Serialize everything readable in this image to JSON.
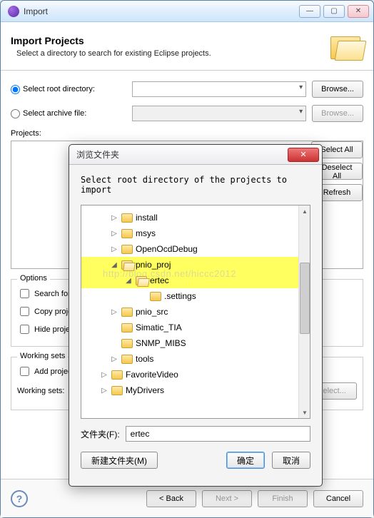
{
  "window": {
    "title": "Import",
    "banner_title": "Import Projects",
    "banner_desc": "Select a directory to search for existing Eclipse projects."
  },
  "source": {
    "root_label": "Select root directory:",
    "archive_label": "Select archive file:",
    "browse": "Browse...",
    "root_selected": true
  },
  "projects": {
    "label": "Projects:",
    "select_all": "Select All",
    "deselect_all": "Deselect All",
    "refresh": "Refresh"
  },
  "options": {
    "title": "Options",
    "search": "Search for nested projects",
    "copy": "Copy projects into workspace",
    "hide": "Hide projects that already exist in the workspace"
  },
  "working": {
    "title": "Working sets",
    "add": "Add project to working sets",
    "ws_label": "Working sets:",
    "select": "Select..."
  },
  "footer": {
    "back": "< Back",
    "next": "Next >",
    "finish": "Finish",
    "cancel": "Cancel"
  },
  "modal": {
    "title": "浏览文件夹",
    "message": "Select root directory of the projects to import",
    "path_label": "文件夹(F):",
    "path_value": "ertec",
    "new_folder": "新建文件夹(M)",
    "ok": "确定",
    "cancel": "取消",
    "watermark": "http://blog.csdn.net/hiccc2012",
    "tree": [
      {
        "label": "install",
        "indent": 40,
        "expander": "▷",
        "hl": false,
        "open": false
      },
      {
        "label": "msys",
        "indent": 40,
        "expander": "▷",
        "hl": false,
        "open": false
      },
      {
        "label": "OpenOcdDebug",
        "indent": 40,
        "expander": "▷",
        "hl": false,
        "open": false
      },
      {
        "label": "pnio_proj",
        "indent": 40,
        "expander": "◢",
        "hl": true,
        "open": true
      },
      {
        "label": "ertec",
        "indent": 60,
        "expander": "◢",
        "hl": true,
        "open": true
      },
      {
        "label": ".settings",
        "indent": 80,
        "expander": "",
        "hl": false,
        "open": false
      },
      {
        "label": "pnio_src",
        "indent": 40,
        "expander": "▷",
        "hl": false,
        "open": false
      },
      {
        "label": "Simatic_TIA",
        "indent": 40,
        "expander": "",
        "hl": false,
        "open": false
      },
      {
        "label": "SNMP_MIBS",
        "indent": 40,
        "expander": "",
        "hl": false,
        "open": false
      },
      {
        "label": "tools",
        "indent": 40,
        "expander": "▷",
        "hl": false,
        "open": false
      },
      {
        "label": "FavoriteVideo",
        "indent": 26,
        "expander": "▷",
        "hl": false,
        "open": false
      },
      {
        "label": "MyDrivers",
        "indent": 26,
        "expander": "▷",
        "hl": false,
        "open": false
      }
    ]
  }
}
